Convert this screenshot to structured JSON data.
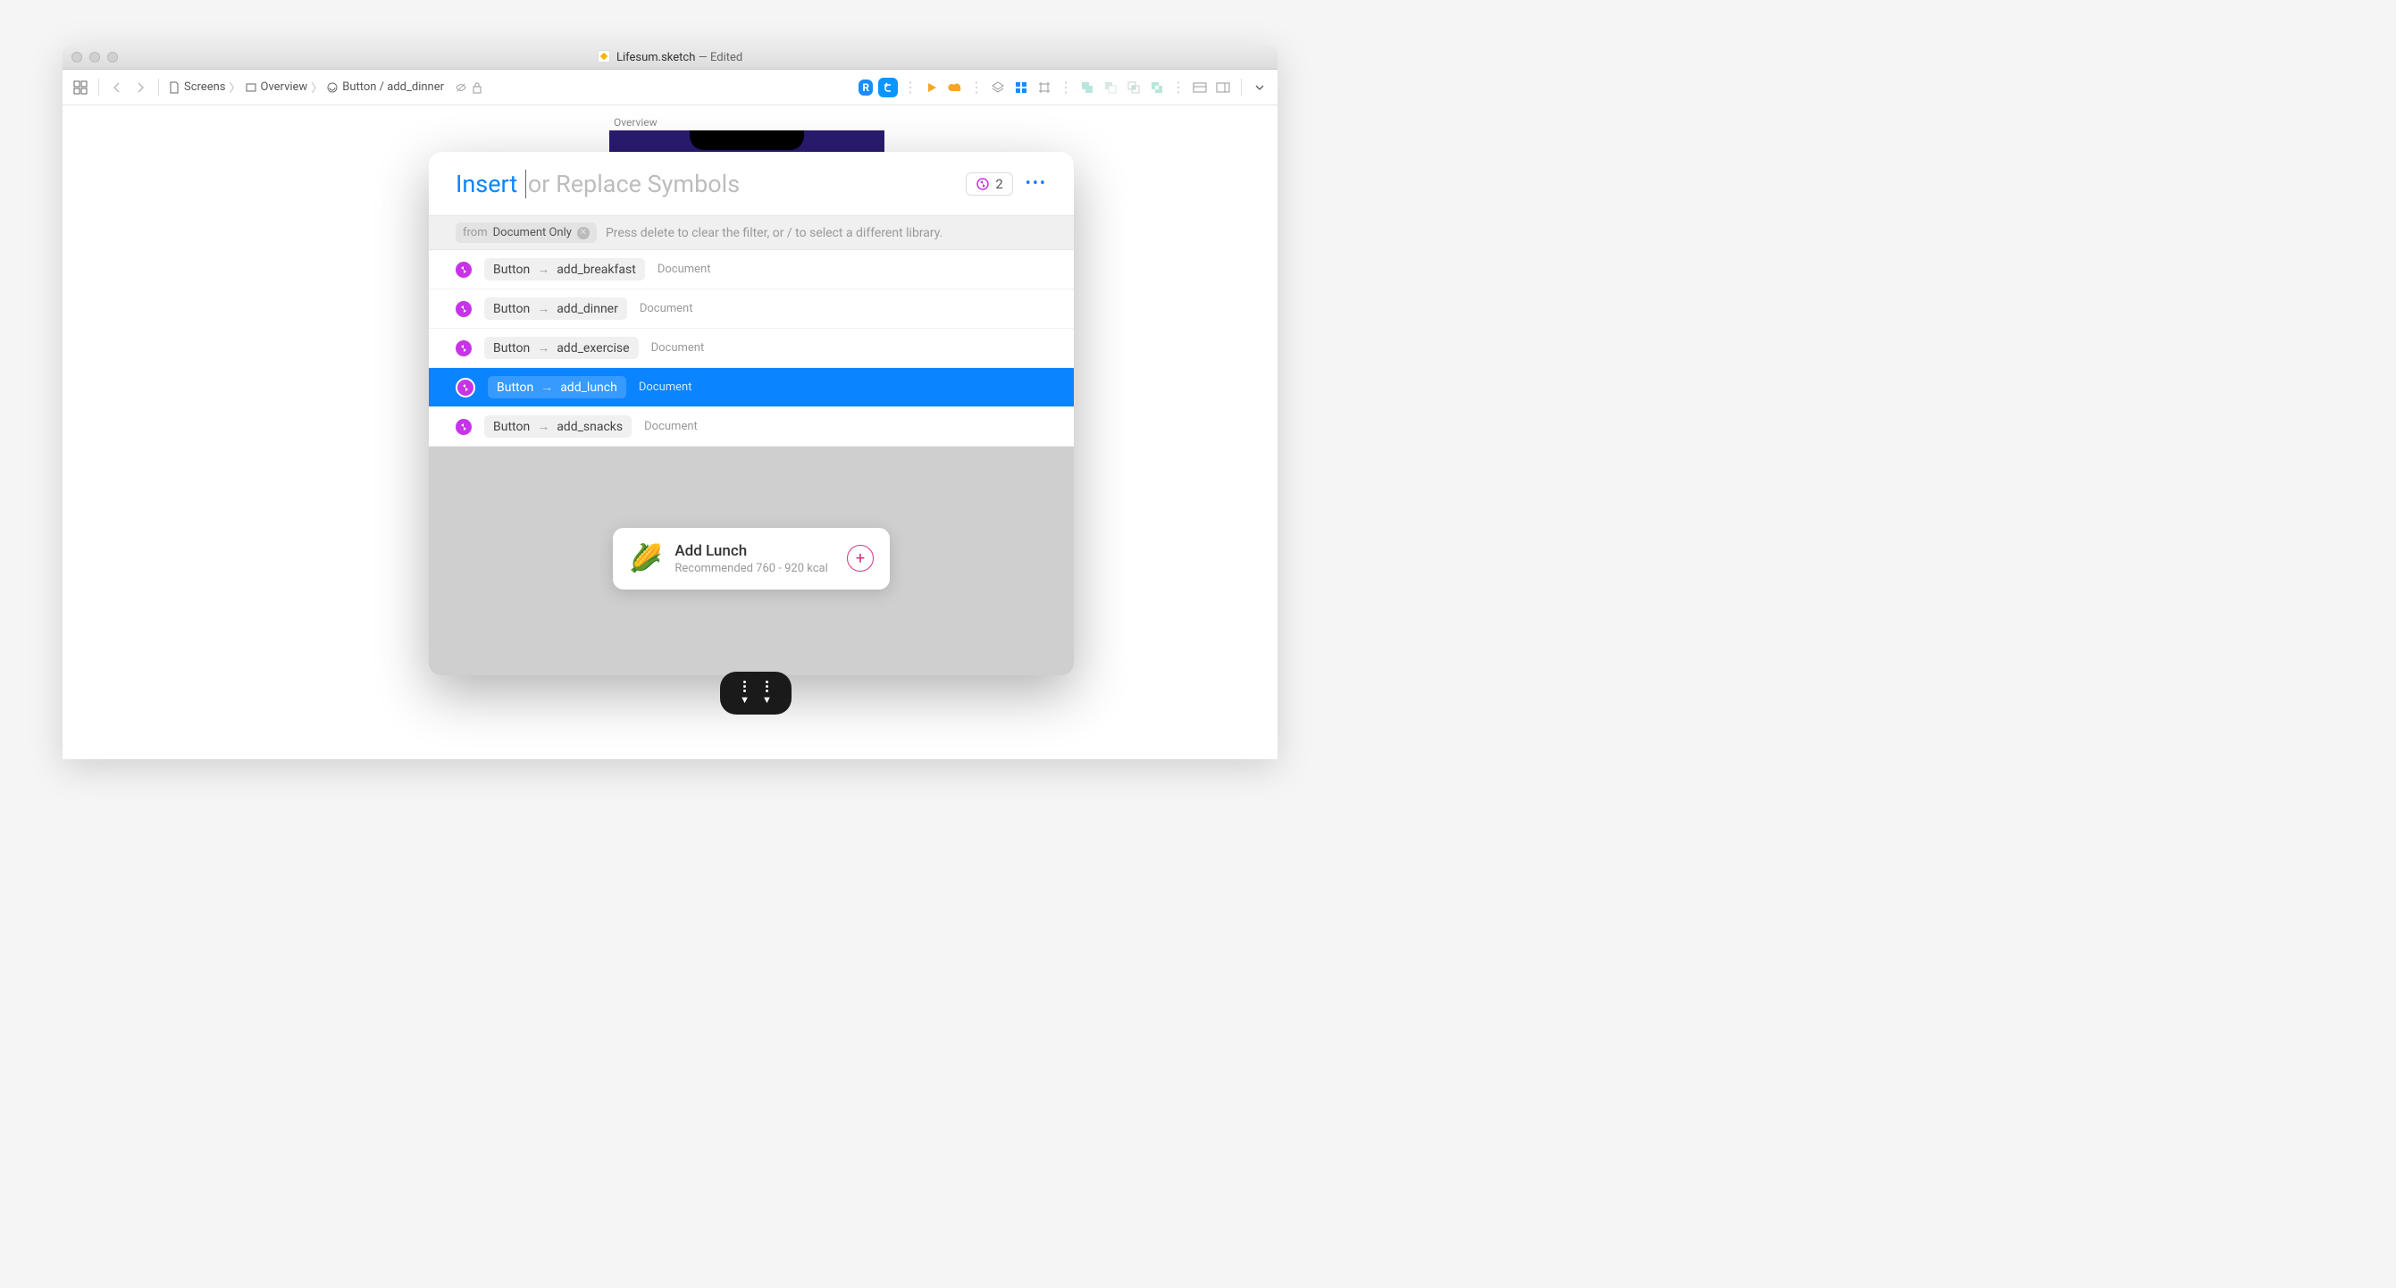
{
  "window": {
    "filename": "Lifesum.sketch",
    "status": "— Edited"
  },
  "breadcrumb": {
    "items": [
      "Screens",
      "Overview",
      "Button / add_dinner"
    ]
  },
  "artboard_label": "Overview",
  "popup": {
    "title_highlight": "Insert",
    "title_rest": "or Replace Symbols",
    "count": "2",
    "filter": {
      "from_label": "from",
      "from_value": "Document Only",
      "hint": "Press delete to clear the filter, or / to select a different library."
    },
    "results": [
      {
        "group": "Button",
        "name": "add_breakfast",
        "source": "Document",
        "selected": false
      },
      {
        "group": "Button",
        "name": "add_dinner",
        "source": "Document",
        "selected": false
      },
      {
        "group": "Button",
        "name": "add_exercise",
        "source": "Document",
        "selected": false
      },
      {
        "group": "Button",
        "name": "add_lunch",
        "source": "Document",
        "selected": true
      },
      {
        "group": "Button",
        "name": "add_snacks",
        "source": "Document",
        "selected": false
      }
    ],
    "preview": {
      "title": "Add Lunch",
      "subtitle": "Recommended 760 - 920 kcal"
    }
  }
}
